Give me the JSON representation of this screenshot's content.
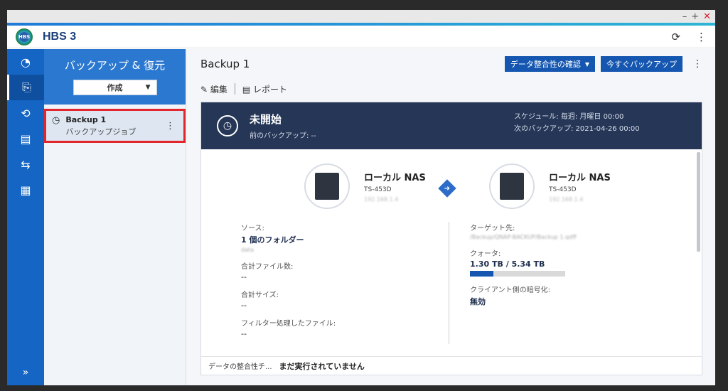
{
  "app": {
    "name": "HBS 3",
    "logo_text": "HBS"
  },
  "window_controls": {
    "minimize": "–",
    "maximize": "+",
    "close": "✕"
  },
  "appbar": {
    "refresh_icon": "⟳",
    "more_icon": "⋮"
  },
  "rail": {
    "icons": [
      "◔",
      "⎘",
      "⟲",
      "▤",
      "⇆",
      "▦"
    ],
    "collapse": "»"
  },
  "panel": {
    "title": "バックアップ & 復元",
    "create_label": "作成",
    "jobs": [
      {
        "name": "Backup 1",
        "type": "バックアップジョブ"
      }
    ]
  },
  "main": {
    "title": "Backup 1",
    "verify_button": "データ整合性の確認",
    "backup_now_button": "今すぐバックアップ",
    "toolbar": {
      "edit": "編集",
      "report": "レポート"
    },
    "banner": {
      "status": "未開始",
      "last_backup": "前のバックアップ: --",
      "schedule": "スケジュール: 毎週: 月曜日 00:00",
      "next_backup": "次のバックアップ: 2021-04-26 00:00"
    },
    "source_nas": {
      "name": "ローカル NAS",
      "model": "TS-453D",
      "ip": "192.168.1.4"
    },
    "target_nas": {
      "name": "ローカル NAS",
      "model": "TS-453D",
      "ip": "192.168.1.4"
    },
    "source": {
      "source_label": "ソース:",
      "source_value": "1 個のフォルダー",
      "source_blur": "data",
      "files_label": "合計ファイル数:",
      "files_value": "--",
      "size_label": "合計サイズ:",
      "size_value": "--",
      "filtered_label": "フィルター処理したファイル:",
      "filtered_value": "--"
    },
    "target": {
      "target_label": "ターゲット先:",
      "target_blur": "/Backup/QNAP-BACKUP/Backup 1.qdff",
      "quota_label": "クォータ:",
      "quota_used": "1.30 TB",
      "quota_total": "5.34 TB",
      "quota_fraction": 0.243,
      "encryption_label": "クライアント側の暗号化:",
      "encryption_value": "無効"
    },
    "footer": {
      "label": "データの整合性チ...",
      "value": "まだ実行されていません"
    }
  }
}
